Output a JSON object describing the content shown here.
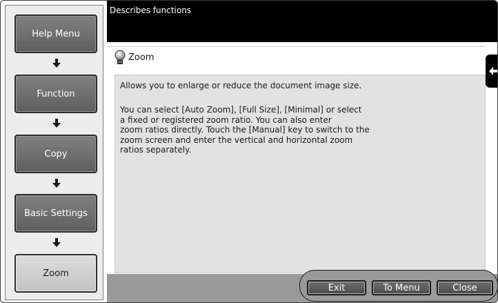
{
  "header": {
    "description": "Describes functions"
  },
  "nav": {
    "items": [
      {
        "label": "Help Menu"
      },
      {
        "label": "Function"
      },
      {
        "label": "Copy"
      },
      {
        "label": "Basic Settings"
      },
      {
        "label": "Zoom"
      }
    ]
  },
  "panel": {
    "title": "Zoom",
    "title_icon": "lightbulb-icon",
    "paragraph1": "Allows you to enlarge or reduce the document image size.",
    "paragraph2_lines": [
      "You can select [Auto Zoom], [Full Size], [Minimal] or select",
      "a fixed or registered zoom ratio. You can also enter",
      "zoom ratios directly. Touch the  [Manual] key to switch to the",
      "zoom screen and enter the vertical and horizontal zoom",
      "ratios separately."
    ]
  },
  "side_tab": {
    "icon": "collapse-left-arrow-icon"
  },
  "footer": {
    "exit_label": "Exit",
    "to_menu_label": "To Menu",
    "close_label": "Close"
  }
}
